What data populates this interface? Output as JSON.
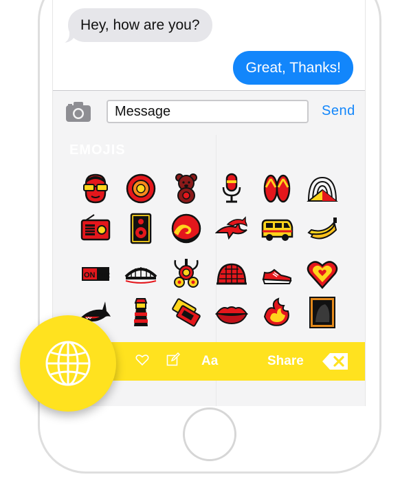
{
  "chat": {
    "incoming": "Hey, how are you?",
    "outgoing": "Great, Thanks!"
  },
  "composer": {
    "value": "Message",
    "send_label": "Send",
    "camera_icon": "camera-icon"
  },
  "keyboard": {
    "section_title": "EMOJIS",
    "emojis": [
      [
        "face-with-sunglasses",
        "red-target-disc",
        "teddy-bear",
        "microphone",
        "flip-flops",
        "radio-signal-dome"
      ],
      [
        "radio",
        "speaker",
        "wave-circle",
        "dolphins",
        "van",
        "bananas"
      ],
      [
        "on-air-sign",
        "bridge",
        "skull-crossbones-horns",
        "igloo-dome",
        "sneaker",
        "heart"
      ],
      [
        "shark",
        "lighthouse",
        "tickets",
        "lips",
        "flame-chili",
        "framed-picture"
      ]
    ],
    "on_air_text": "ON AIR",
    "toolbar": {
      "heart_icon": "heart-outline-icon",
      "edit_icon": "edit-icon",
      "font_label": "Aa",
      "share_label": "Share",
      "delete_icon": "backspace-icon"
    }
  },
  "globe_button_icon": "globe-icon",
  "colors": {
    "accent_blue": "#1286fb",
    "toolbar_yellow": "#ffe21f",
    "emoji_red": "#e4171c",
    "emoji_yellow": "#ffd51c"
  }
}
